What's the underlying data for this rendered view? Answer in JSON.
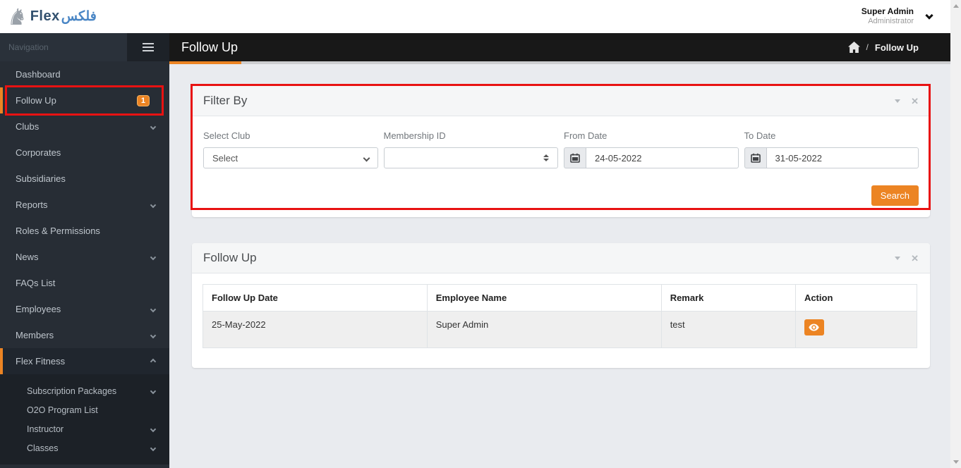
{
  "brand": {
    "name": "Flex",
    "name_arabic": "فلكس"
  },
  "user": {
    "name": "Super Admin",
    "role": "Administrator"
  },
  "sidebar": {
    "section_label": "Navigation",
    "items": [
      {
        "label": "Dashboard"
      },
      {
        "label": "Follow Up",
        "badge": "1"
      },
      {
        "label": "Clubs"
      },
      {
        "label": "Corporates"
      },
      {
        "label": "Subsidiaries"
      },
      {
        "label": "Reports"
      },
      {
        "label": "Roles & Permissions"
      },
      {
        "label": "News"
      },
      {
        "label": "FAQs List"
      },
      {
        "label": "Employees"
      },
      {
        "label": "Members"
      },
      {
        "label": "Flex Fitness"
      }
    ],
    "submenu": [
      {
        "label": "Subscription Packages"
      },
      {
        "label": "O2O Program List"
      },
      {
        "label": "Instructor"
      },
      {
        "label": "Classes"
      }
    ]
  },
  "topbar": {
    "title": "Follow Up",
    "breadcrumb": {
      "separator": "/",
      "current": "Follow Up"
    }
  },
  "filter_panel": {
    "title": "Filter By",
    "fields": {
      "select_club": {
        "label": "Select Club",
        "value": "Select"
      },
      "membership_id": {
        "label": "Membership ID",
        "value": ""
      },
      "from_date": {
        "label": "From Date",
        "value": "24-05-2022"
      },
      "to_date": {
        "label": "To Date",
        "value": "31-05-2022"
      }
    },
    "search_label": "Search"
  },
  "table_panel": {
    "title": "Follow Up",
    "columns": [
      "Follow Up Date",
      "Employee Name",
      "Remark",
      "Action"
    ],
    "rows": [
      {
        "date": "25-May-2022",
        "employee": "Super Admin",
        "remark": "test"
      }
    ]
  },
  "icons": {
    "close": "✕",
    "horse": "♞"
  },
  "colors": {
    "accent": "#ec8423",
    "annotation_red": "#e81212",
    "sidebar_bg": "#272d35",
    "topbar_dark": "#181818"
  }
}
